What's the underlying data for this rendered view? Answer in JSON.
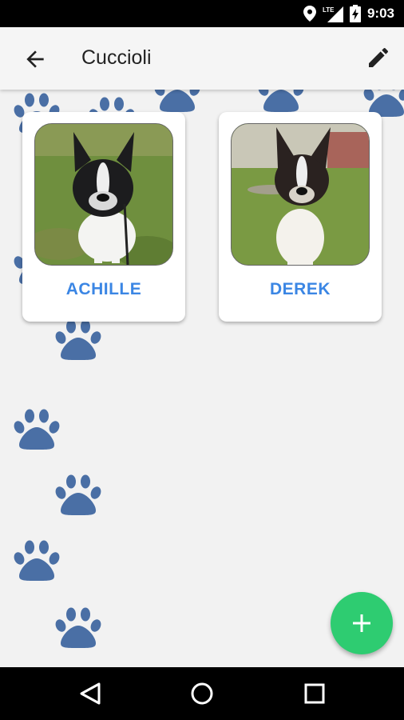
{
  "status_bar": {
    "time": "9:03",
    "network": "LTE",
    "icons": [
      "location-icon",
      "signal-icon",
      "battery-charging-icon"
    ]
  },
  "app_bar": {
    "title": "Cuccioli",
    "back_icon": "arrow-back-icon",
    "edit_icon": "pencil-icon"
  },
  "puppies": [
    {
      "name": "ACHILLE"
    },
    {
      "name": "DEREK"
    }
  ],
  "fab": {
    "icon": "plus-icon",
    "color": "#2ecc71"
  },
  "nav_bar": {
    "icons": [
      "back-triangle-icon",
      "home-circle-icon",
      "recents-square-icon"
    ]
  },
  "colors": {
    "accent": "#3b86e4",
    "paw": "#4a6fa5",
    "background": "#f2f2f2"
  }
}
